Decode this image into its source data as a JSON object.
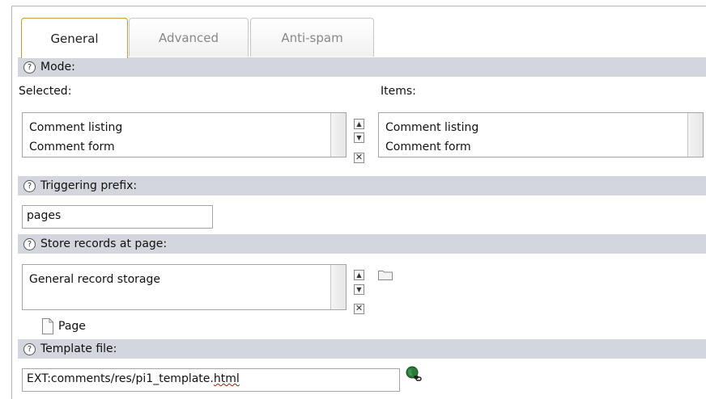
{
  "tabs": [
    {
      "label": "General",
      "active": true
    },
    {
      "label": "Advanced",
      "active": false
    },
    {
      "label": "Anti-spam",
      "active": false
    }
  ],
  "help_glyph": "?",
  "mode": {
    "title": "Mode:",
    "selected_label": "Selected:",
    "items_label": "Items:",
    "selected": [
      "Comment listing",
      "Comment form"
    ],
    "items": [
      "Comment listing",
      "Comment form"
    ]
  },
  "prefix": {
    "title": "Triggering prefix:",
    "value": "pages"
  },
  "storage": {
    "title": "Store records at page:",
    "selected": [
      "General record storage"
    ],
    "page_label": "Page"
  },
  "template": {
    "title": "Template file:",
    "value_prefix": "EXT:comments/res/pi1_template.",
    "value_suffix": "html"
  },
  "controls": {
    "up": "▲",
    "down": "▼",
    "remove": "✕"
  },
  "colors": {
    "section_bg": "#d3d6dc",
    "active_tab_border": "#c59a3a"
  }
}
